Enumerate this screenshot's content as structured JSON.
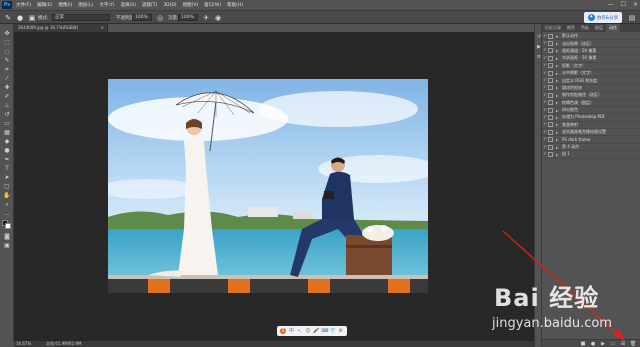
{
  "menubar": {
    "logo": "Ps",
    "items": [
      "文件(F)",
      "编辑(E)",
      "图像(I)",
      "图层(L)",
      "文字(Y)",
      "选择(S)",
      "滤镜(T)",
      "3D(D)",
      "视图(V)",
      "窗口(W)",
      "帮助(H)"
    ],
    "controls": [
      "—",
      "☐",
      "✕"
    ]
  },
  "options": {
    "mode_label": "模式:",
    "mode_value": "正常",
    "opacity_label": "不透明度:",
    "opacity_value": "100%",
    "flow_label": "流量:",
    "flow_value": "100%",
    "share_label": "协作&分享"
  },
  "document": {
    "tab_title": "2644009.jpg @ 16.7%(RGB/8)",
    "close": "×"
  },
  "status": {
    "zoom": "16.67%",
    "doc_info": "文档:61.9M/61.9M"
  },
  "panel": {
    "tabs": [
      "历史记录",
      "颜色",
      "色板",
      "图层",
      "动作"
    ],
    "active_tab": "动作",
    "rows": [
      {
        "label": "默认动作",
        "checked": true,
        "group": true
      },
      {
        "label": "淡出效果（选区）",
        "checked": true
      },
      {
        "label": "画框通道 - 50 像素",
        "checked": true
      },
      {
        "label": "木质画框 - 50 像素",
        "checked": true
      },
      {
        "label": "投影（文字）",
        "checked": true
      },
      {
        "label": "水中倒影（文字）",
        "checked": true
      },
      {
        "label": "自定义 RGB 到灰度",
        "checked": true
      },
      {
        "label": "熔化的铅块",
        "checked": true
      },
      {
        "label": "制作剪贴路径（选区）",
        "checked": true
      },
      {
        "label": "棕褐色调（图层）",
        "checked": true
      },
      {
        "label": "四分颜色",
        "checked": true
      },
      {
        "label": "存储为 Photoshop PDF",
        "checked": true
      },
      {
        "label": "渐变映射",
        "checked": true
      },
      {
        "label": "混合器画笔克隆绘图设置",
        "checked": true
      },
      {
        "label": "PS dark frame",
        "checked": true,
        "group": true
      },
      {
        "label": "第 4 动作",
        "checked": true,
        "group": true
      },
      {
        "label": "组 1",
        "checked": true,
        "group": true
      }
    ]
  },
  "floatbar": {
    "items": [
      "S",
      "中",
      "•,",
      "☺",
      "🎤",
      "⌨",
      "👕",
      "⚙"
    ]
  },
  "watermark": {
    "brand": "Bai 经验",
    "url": "jingyan.baidu.com"
  }
}
